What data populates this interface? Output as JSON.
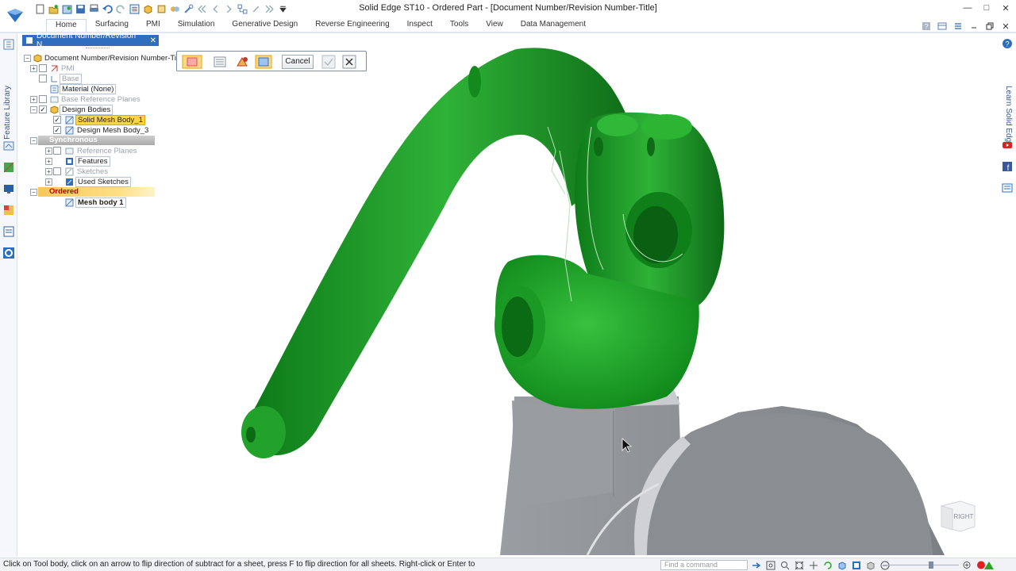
{
  "window": {
    "title": "Solid Edge ST10 - Ordered Part - [Document Number/Revision Number-Title]"
  },
  "ribbon": {
    "tabs": [
      "Home",
      "Surfacing",
      "PMI",
      "Simulation",
      "Generative Design",
      "Reverse Engineering",
      "Inspect",
      "Tools",
      "View",
      "Data Management"
    ],
    "active_tab": "Home"
  },
  "left_strip": {
    "label": "Feature Library"
  },
  "right_strip": {
    "label": "Learn Solid Edge"
  },
  "pathfinder": {
    "tab_title": "Document Number/Revision N...",
    "tree": {
      "root": "Document Number/Revision Number-Title",
      "pmi": "PMI",
      "base": "Base",
      "material": "Material (None)",
      "base_reference_planes": "Base Reference Planes",
      "design_bodies": "Design Bodies",
      "solid_mesh_body": "Solid Mesh Body_1",
      "design_mesh_body": "Design Mesh Body_3",
      "synchronous": "Synchronous",
      "reference_planes": "Reference Planes",
      "features": "Features",
      "sketches": "Sketches",
      "used_sketches": "Used Sketches",
      "ordered": "Ordered",
      "mesh_body": "Mesh body 1"
    }
  },
  "command_bar": {
    "cancel_label": "Cancel"
  },
  "viewport": {
    "view_cube_label": "RIGHT",
    "colors": {
      "tool_body": "#1f9a2a",
      "tool_body_dark": "#0d6a16",
      "target_body": "#8d9095",
      "target_light": "#c6c8cc"
    }
  },
  "status": {
    "prompt": "Click on Tool body, click on an arrow to flip direction of subtract for a sheet, press F to flip direction for all sheets. Right-click or Enter to acce",
    "find_placeholder": "Find a command"
  }
}
